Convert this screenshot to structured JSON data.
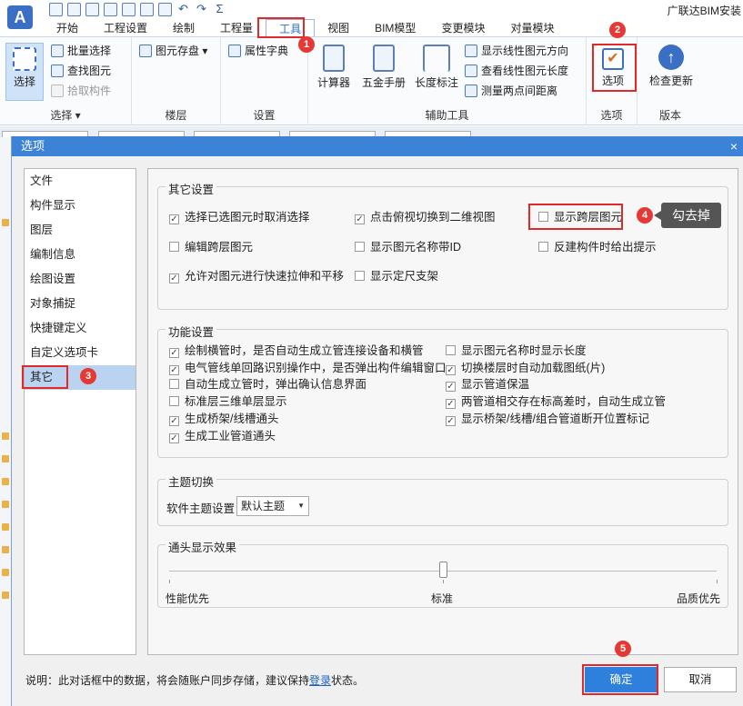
{
  "app": {
    "logo": "A",
    "title": "广联达BIM安装",
    "qat_icons": [
      "new-icon",
      "open-icon",
      "save-icon",
      "cloud-icon",
      "grid-icon",
      "export-icon",
      "import-icon",
      "undo-icon",
      "redo-icon",
      "sum-icon"
    ]
  },
  "tabs": [
    "开始",
    "工程设置",
    "绘制",
    "工程量",
    "工具",
    "视图",
    "BIM模型",
    "变更模块",
    "对量模块"
  ],
  "ribbon": {
    "select_group": {
      "big": "选择",
      "items": [
        "批量选择",
        "查找图元",
        "拾取构件"
      ],
      "label": "选择"
    },
    "floor_group": {
      "item": "图元存盘",
      "label": "楼层"
    },
    "settings_group": {
      "item": "属性字典",
      "label": "设置"
    },
    "aux_group": {
      "big": [
        "计算器",
        "五金手册",
        "长度标注"
      ],
      "items": [
        "显示线性图元方向",
        "查看线性图元长度",
        "测量两点间距离"
      ],
      "label": "辅助工具"
    },
    "options_group": {
      "big": "选项",
      "label": "选项"
    },
    "version_group": {
      "big": "检查更新",
      "label": "版本"
    }
  },
  "dialog": {
    "title": "选项",
    "close": "×",
    "sidebar": [
      "文件",
      "构件显示",
      "图层",
      "编制信息",
      "绘图设置",
      "对象捕捉",
      "快捷键定义",
      "自定义选项卡",
      "其它"
    ],
    "other": {
      "title": "其它设置",
      "options": [
        {
          "label": "选择已选图元时取消选择",
          "checked": true
        },
        {
          "label": "点击俯视切换到二维视图",
          "checked": true
        },
        {
          "label": "显示跨层图元",
          "checked": false
        },
        {
          "label": "编辑跨层图元",
          "checked": false
        },
        {
          "label": "显示图元名称带ID",
          "checked": false
        },
        {
          "label": "反建构件时给出提示",
          "checked": false
        },
        {
          "label": "允许对图元进行快速拉伸和平移",
          "checked": true
        },
        {
          "label": "显示定尺支架",
          "checked": false
        }
      ]
    },
    "func": {
      "title": "功能设置",
      "left": [
        {
          "label": "绘制横管时，是否自动生成立管连接设备和横管",
          "checked": true
        },
        {
          "label": "电气管线单回路识别操作中，是否弹出构件编辑窗口",
          "checked": true
        },
        {
          "label": "自动生成立管时，弹出确认信息界面",
          "checked": false
        },
        {
          "label": "标准层三维单层显示",
          "checked": false
        },
        {
          "label": "生成桥架/线槽通头",
          "checked": true
        },
        {
          "label": "生成工业管道通头",
          "checked": true
        }
      ],
      "right": [
        {
          "label": "显示图元名称时显示长度",
          "checked": false
        },
        {
          "label": "切换楼层时自动加载图纸(片)",
          "checked": true
        },
        {
          "label": "显示管道保温",
          "checked": true
        },
        {
          "label": "两管道相交存在标高差时，自动生成立管",
          "checked": true
        },
        {
          "label": "显示桥架/线槽/组合管道断开位置标记",
          "checked": true
        }
      ]
    },
    "theme": {
      "title": "主题切换",
      "label": "软件主题设置",
      "value": "默认主题"
    },
    "fitting": {
      "title": "通头显示效果",
      "left": "性能优先",
      "mid": "标准",
      "right": "品质优先",
      "level": 0.5
    },
    "note": {
      "prefix": "说明：此对话框中的数据，将会随账户同步存储，建议保持",
      "link": "登录",
      "suffix": "状态。"
    },
    "ok": "确定",
    "cancel": "取消"
  },
  "annotations": {
    "badges": [
      "1",
      "2",
      "3",
      "4",
      "5"
    ],
    "callout": "勾去掉",
    "colors": {
      "accent": "#2f7fdc",
      "annotation": "#e02a2a"
    }
  }
}
